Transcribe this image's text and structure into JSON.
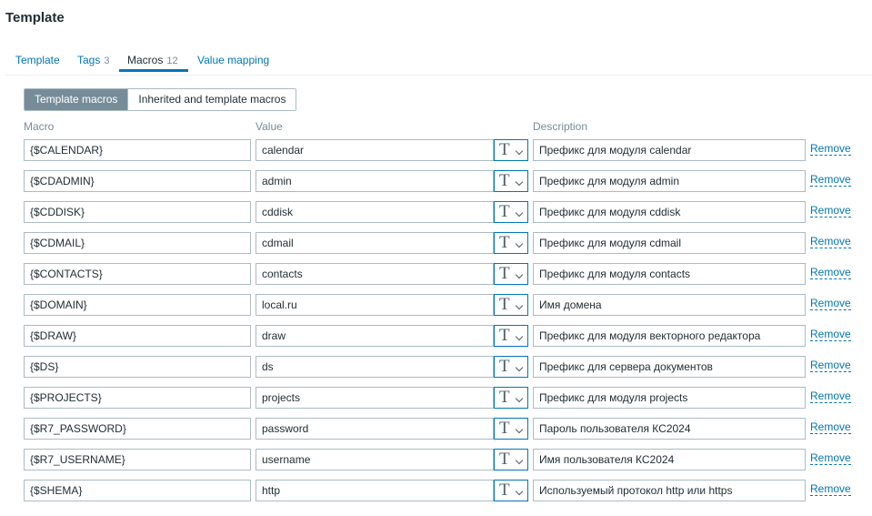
{
  "header": {
    "title": "Template"
  },
  "tabs": [
    {
      "label": "Template",
      "count": ""
    },
    {
      "label": "Tags",
      "count": "3"
    },
    {
      "label": "Macros",
      "count": "12"
    },
    {
      "label": "Value mapping",
      "count": ""
    }
  ],
  "macro_view": {
    "options": [
      "Template macros",
      "Inherited and template macros"
    ],
    "selected": "Template macros"
  },
  "table": {
    "headers": {
      "macro": "Macro",
      "value": "Value",
      "description": "Description"
    },
    "value_type_icon": "text-type-icon",
    "remove_label": "Remove",
    "rows": [
      {
        "macro": "{$CALENDAR}",
        "value": "calendar",
        "description": "Префикс для модуля calendar"
      },
      {
        "macro": "{$CDADMIN}",
        "value": "admin",
        "description": "Префикс для модуля admin"
      },
      {
        "macro": "{$CDDISK}",
        "value": "cddisk",
        "description": "Префикс для модуля cddisk"
      },
      {
        "macro": "{$CDMAIL}",
        "value": "cdmail",
        "description": "Префикс для модуля cdmail"
      },
      {
        "macro": "{$CONTACTS}",
        "value": "contacts",
        "description": "Префикс для модуля contacts"
      },
      {
        "macro": "{$DOMAIN}",
        "value": "local.ru",
        "description": "Имя домена"
      },
      {
        "macro": "{$DRAW}",
        "value": "draw",
        "description": "Префикс для модуля векторного редактора"
      },
      {
        "macro": "{$DS}",
        "value": "ds",
        "description": "Префикс для сервера документов"
      },
      {
        "macro": "{$PROJECTS}",
        "value": "projects",
        "description": "Префикс для модуля projects"
      },
      {
        "macro": "{$R7_PASSWORD}",
        "value": "password",
        "description": "Пароль пользователя КС2024"
      },
      {
        "macro": "{$R7_USERNAME}",
        "value": "username",
        "description": "Имя пользователя КС2024"
      },
      {
        "macro": "{$SHEMA}",
        "value": "http",
        "description": "Используемый протокол http или https"
      }
    ]
  },
  "colors": {
    "link": "#0275b8",
    "border": "#acbbc2",
    "muted": "#768d99",
    "active_segment": "#768d99"
  }
}
